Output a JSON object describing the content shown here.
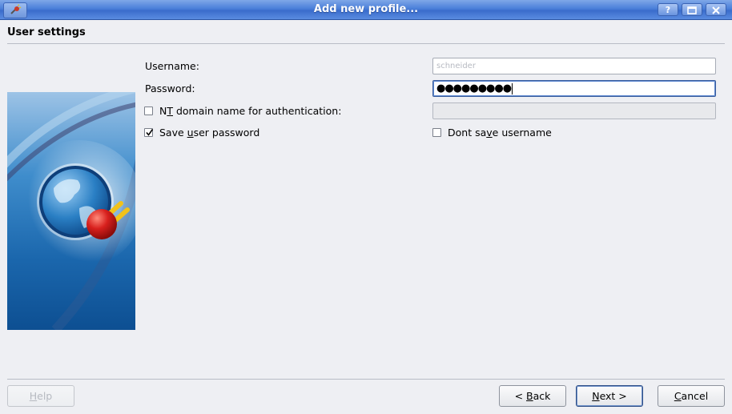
{
  "window": {
    "title": "Add new profile...",
    "help_icon": "?",
    "icons": [
      "app-plug-icon",
      "help-icon",
      "maximize-icon",
      "close-icon"
    ]
  },
  "header": {
    "title": "User settings"
  },
  "form": {
    "username": {
      "label": "Username:",
      "value": "schneider"
    },
    "password": {
      "label": "Password:",
      "value": "●●●●●●●●●"
    },
    "nt_domain": {
      "label_prefix": "N",
      "label_mnemonic": "T",
      "label_suffix": " domain name for authentication:",
      "checked": false,
      "value": ""
    },
    "save_password": {
      "label_prefix": "Save ",
      "label_mnemonic": "u",
      "label_suffix": "ser password",
      "checked": true
    },
    "dont_save_username": {
      "label_prefix": "Dont sa",
      "label_mnemonic": "v",
      "label_suffix": "e username",
      "checked": false
    }
  },
  "buttons": {
    "help": {
      "mnemonic": "H",
      "rest": "elp",
      "enabled": false
    },
    "back": {
      "prefix": "< ",
      "mnemonic": "B",
      "rest": "ack"
    },
    "next": {
      "mnemonic": "N",
      "rest": "ext >"
    },
    "cancel": {
      "mnemonic": "C",
      "rest": "ancel"
    }
  },
  "colors": {
    "titlebar": "#4a7fd9",
    "window_bg": "#eeeff3",
    "image_bg": "#1f6fb3",
    "plug_red": "#d8201d",
    "plug_prongs": "#f2c21a"
  }
}
